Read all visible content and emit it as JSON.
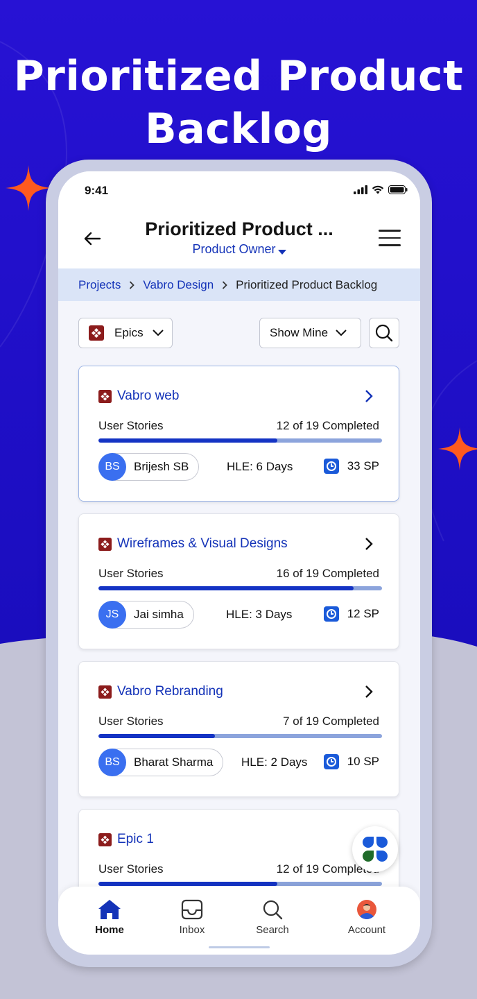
{
  "headline": {
    "line1": "Prioritized Product",
    "line2": "Backlog"
  },
  "colors": {
    "hero": "#2a13d6",
    "accent": "#1433b8",
    "progress_fill": "#1433c4",
    "progress_track": "#8ca4dc",
    "breadcrumb_bg": "#dae4f7",
    "sparkle": "#ff5a1f"
  },
  "status_bar": {
    "time": "9:41"
  },
  "app_bar": {
    "title": "Prioritized Product ...",
    "subtitle": "Product Owner"
  },
  "breadcrumb": {
    "items": [
      "Projects",
      "Vabro Design",
      "Prioritized Product Backlog"
    ]
  },
  "filters": {
    "type_label": "Epics",
    "scope_label": "Show Mine"
  },
  "epics": [
    {
      "title": "Vabro web",
      "stories_label": "User Stories",
      "completed_text": "12 of 19 Completed",
      "progress": 0.63,
      "owner_initials": "BS",
      "owner_name": "Brijesh SB",
      "hle": "HLE: 6 Days",
      "sp": "33 SP"
    },
    {
      "title": "Wireframes & Visual Designs",
      "stories_label": "User Stories",
      "completed_text": "16 of 19 Completed",
      "progress": 0.9,
      "owner_initials": "JS",
      "owner_name": "Jai simha",
      "hle": "HLE: 3 Days",
      "sp": "12 SP"
    },
    {
      "title": "Vabro Rebranding",
      "stories_label": "User Stories",
      "completed_text": "7 of 19 Completed",
      "progress": 0.41,
      "owner_initials": "BS",
      "owner_name": "Bharat Sharma",
      "hle": "HLE: 2 Days",
      "sp": "10 SP"
    },
    {
      "title": "Epic 1",
      "stories_label": "User Stories",
      "completed_text": "12 of 19 Completed",
      "progress": 0.63
    }
  ],
  "tabbar": {
    "items": [
      "Home",
      "Inbox",
      "Search",
      "Account"
    ],
    "active": "Home"
  }
}
